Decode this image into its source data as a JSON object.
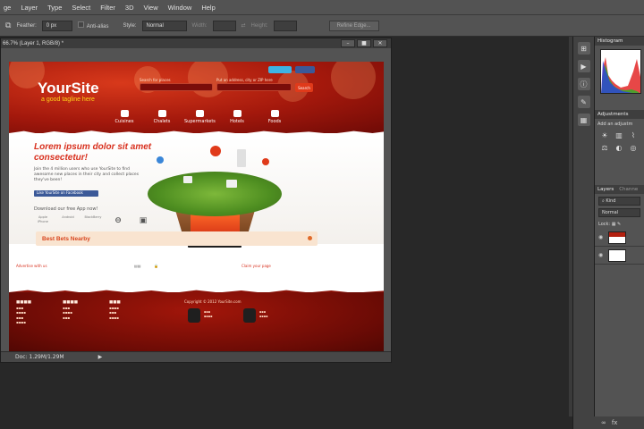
{
  "menu": [
    "ge",
    "Layer",
    "Type",
    "Select",
    "Filter",
    "3D",
    "View",
    "Window",
    "Help"
  ],
  "options": {
    "feather_label": "Feather:",
    "feather_value": "0 px",
    "anti_alias": "Anti-alias",
    "style_label": "Style:",
    "style_value": "Normal",
    "width_label": "Width:",
    "height_label": "Height:",
    "refine_edge": "Refine Edge..."
  },
  "document": {
    "title": "66.7% (Layer 1, RGB/8) *",
    "status": "Doc: 1.29M/1.29M"
  },
  "site": {
    "logo": "YourSite",
    "tagline": "a good tagline here",
    "search_label_1": "Search for places",
    "search_label_2": "Put an address, city or ZIP here",
    "search_button": "Search",
    "nav": [
      "Cuisines",
      "Chalets",
      "Supermarkets",
      "Hotels",
      "Foods"
    ],
    "hero_title": "Lorem ipsum dolor sit amet consectetur!",
    "hero_text": "Join the 4 million users who use YourSite to find awesome new places in their city and collect places they've been!",
    "fb_like": "Like YourSite on Facebook",
    "download": "Download our free App now!",
    "apps": [
      {
        "icon": "",
        "label": "Apple iPhone"
      },
      {
        "icon": "",
        "label": "Android"
      },
      {
        "icon": "",
        "label": "BlackBerry"
      },
      {
        "icon": "⊖",
        "label": ""
      },
      {
        "icon": "▣",
        "label": ""
      }
    ],
    "best_bets": "Best Bets Nearby",
    "advertise": "Advertise with us",
    "claim": "Claim your page",
    "footer_copy": "Copyright © 2012 YourSite.com"
  },
  "panels": {
    "histogram_tab": "Histogram",
    "adjustments_tab": "Adjustments",
    "add_adjustment": "Add an adjustm",
    "layers_tab": "Layers",
    "channels_tab": "Channe",
    "kind": "Kind",
    "blend_mode": "Normal",
    "lock_label": "Lock:"
  }
}
